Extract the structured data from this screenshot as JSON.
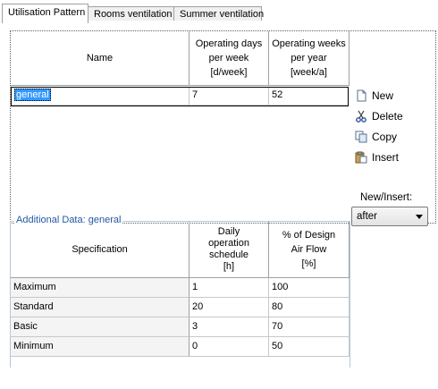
{
  "tabs": [
    {
      "label": "Utilisation Pattern",
      "active": true
    },
    {
      "label": "Rooms ventilation",
      "active": false
    },
    {
      "label": "Summer ventilation",
      "active": false
    }
  ],
  "patterns": {
    "columns": [
      "Name",
      "Operating days per week [d/week]",
      "Operating weeks per year [week/a]"
    ],
    "col_lines": {
      "name": [
        "Name"
      ],
      "days": [
        "Operating days",
        "per week",
        "[d/week]"
      ],
      "weeks": [
        "Operating weeks",
        "per year",
        "[week/a]"
      ]
    },
    "rows": [
      {
        "name": "general",
        "days": "7",
        "weeks": "52"
      }
    ]
  },
  "side_actions": {
    "new": "New",
    "delete": "Delete",
    "copy": "Copy",
    "insert": "Insert",
    "new_insert_label": "New/Insert:",
    "new_insert_value": "after"
  },
  "additional": {
    "legend": "Additional Data: general",
    "col_lines": {
      "spec": [
        "Specification"
      ],
      "schedule": [
        "Daily",
        "operation",
        "schedule",
        "[h]"
      ],
      "airflow": [
        "% of Design",
        "Air Flow",
        "[%]"
      ]
    },
    "rows": [
      {
        "spec": "Maximum",
        "schedule": "1",
        "airflow": "100"
      },
      {
        "spec": "Standard",
        "schedule": "20",
        "airflow": "80"
      },
      {
        "spec": "Basic",
        "schedule": "3",
        "airflow": "70"
      },
      {
        "spec": "Minimum",
        "schedule": "0",
        "airflow": "50"
      }
    ]
  },
  "colors": {
    "selection": "#3399ff",
    "legend": "#2457a8"
  }
}
